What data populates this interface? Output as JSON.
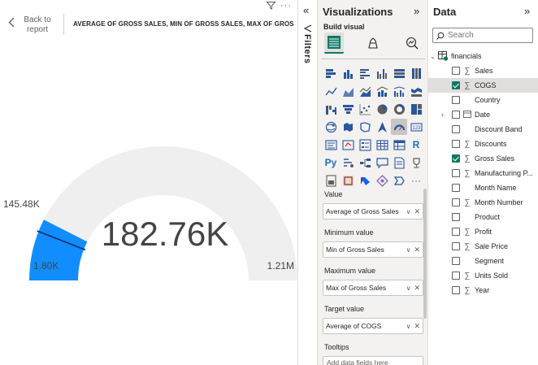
{
  "canvas": {
    "back_label": "Back to report",
    "visual_title": "AVERAGE OF GROSS SALES, MIN OF GROSS SALES, MAX OF GROS...",
    "more_label": "···"
  },
  "gauge": {
    "value": 182760,
    "value_label": "182.76K",
    "min": 1800,
    "min_label": "1.80K",
    "max": 1210000,
    "max_label": "1.21M",
    "target": 145480,
    "target_label": "145.48K",
    "fill_color": "#118dff",
    "track_color": "#efefef",
    "target_color": "#1a2b6e"
  },
  "filters": {
    "label": "Filters"
  },
  "visualizations": {
    "title": "Visualizations",
    "build_label": "Build visual",
    "tabs": [
      "build-visual-tab-icon",
      "format-visual-tab-icon",
      "analytics-tab-icon"
    ],
    "icons": [
      "stacked-bar-chart-icon",
      "stacked-column-chart-icon",
      "clustered-bar-chart-icon",
      "clustered-column-chart-icon",
      "100-stacked-bar-chart-icon",
      "100-stacked-column-chart-icon",
      "line-chart-icon",
      "area-chart-icon",
      "stacked-area-chart-icon",
      "line-and-column-chart-icon",
      "line-clustered-column-chart-icon",
      "ribbon-chart-icon",
      "waterfall-chart-icon",
      "funnel-chart-icon",
      "scatter-chart-icon",
      "pie-chart-icon",
      "donut-chart-icon",
      "treemap-icon",
      "map-icon",
      "filled-map-icon",
      "shape-map-icon",
      "azure-map-icon",
      "gauge-icon",
      "card-icon",
      "multi-row-card-icon",
      "kpi-icon",
      "slicer-icon",
      "table-icon",
      "matrix-icon",
      "r-visual-icon",
      "python-visual-icon",
      "key-influencers-icon",
      "decomposition-tree-icon",
      "qa-icon",
      "narrative-icon",
      "goals-icon",
      "paginated-report-icon",
      "power-apps-icon",
      "power-automate-icon",
      "diamond-visual-icon",
      "chevron-visual-icon",
      "more-visuals-icon"
    ],
    "r_text": "R",
    "py_text": "Py",
    "more_text": "···",
    "wells": [
      {
        "label": "Value",
        "field": "Average of Gross Sales"
      },
      {
        "label": "Minimum value",
        "field": "Min of Gross Sales"
      },
      {
        "label": "Maximum value",
        "field": "Max of Gross Sales"
      },
      {
        "label": "Target value",
        "field": "Average of COGS"
      }
    ],
    "tooltips_label": "Tooltips",
    "tooltips_placeholder": "Add data fields here"
  },
  "data": {
    "title": "Data",
    "search_placeholder": "Search",
    "table_name": "financials",
    "fields": [
      {
        "name": "Sales",
        "sigma": true,
        "checked": false,
        "expandable": false,
        "highlight": false
      },
      {
        "name": "COGS",
        "sigma": true,
        "checked": true,
        "expandable": false,
        "highlight": true
      },
      {
        "name": "Country",
        "sigma": false,
        "checked": false,
        "expandable": false,
        "highlight": false
      },
      {
        "name": "Date",
        "sigma": false,
        "calendar": true,
        "checked": false,
        "expandable": true,
        "highlight": false
      },
      {
        "name": "Discount Band",
        "sigma": false,
        "checked": false,
        "expandable": false,
        "highlight": false
      },
      {
        "name": "Discounts",
        "sigma": true,
        "checked": false,
        "expandable": false,
        "highlight": false
      },
      {
        "name": "Gross Sales",
        "sigma": true,
        "checked": true,
        "expandable": false,
        "highlight": false
      },
      {
        "name": "Manufacturing P...",
        "sigma": true,
        "checked": false,
        "expandable": false,
        "highlight": false
      },
      {
        "name": "Month Name",
        "sigma": false,
        "checked": false,
        "expandable": false,
        "highlight": false
      },
      {
        "name": "Month Number",
        "sigma": true,
        "checked": false,
        "expandable": false,
        "highlight": false
      },
      {
        "name": "Product",
        "sigma": false,
        "checked": false,
        "expandable": false,
        "highlight": false
      },
      {
        "name": "Profit",
        "sigma": true,
        "checked": false,
        "expandable": false,
        "highlight": false
      },
      {
        "name": "Sale Price",
        "sigma": true,
        "checked": false,
        "expandable": false,
        "highlight": false
      },
      {
        "name": "Segment",
        "sigma": false,
        "checked": false,
        "expandable": false,
        "highlight": false
      },
      {
        "name": "Units Sold",
        "sigma": true,
        "checked": false,
        "expandable": false,
        "highlight": false
      },
      {
        "name": "Year",
        "sigma": true,
        "checked": false,
        "expandable": false,
        "highlight": false
      }
    ]
  }
}
